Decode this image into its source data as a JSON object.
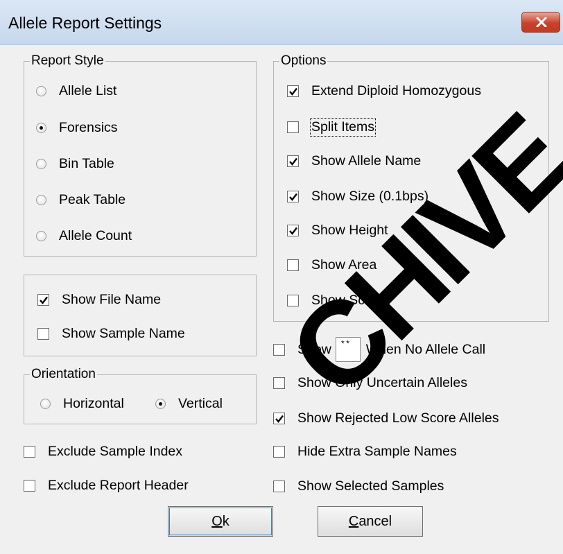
{
  "window": {
    "title": "Allele Report Settings"
  },
  "report_style": {
    "title": "Report Style",
    "options": [
      {
        "label": "Allele List",
        "selected": false
      },
      {
        "label": "Forensics",
        "selected": true
      },
      {
        "label": "Bin Table",
        "selected": false
      },
      {
        "label": "Peak Table",
        "selected": false
      },
      {
        "label": "Allele Count",
        "selected": false
      }
    ]
  },
  "name_options": [
    {
      "label": "Show File Name",
      "checked": true
    },
    {
      "label": "Show Sample Name",
      "checked": false
    }
  ],
  "orientation": {
    "title": "Orientation",
    "options": [
      {
        "label": "Horizontal",
        "selected": false
      },
      {
        "label": "Vertical",
        "selected": true
      }
    ]
  },
  "bottom_left": [
    {
      "label": "Exclude Sample Index",
      "checked": false
    },
    {
      "label": "Exclude Report Header",
      "checked": false
    }
  ],
  "options": {
    "title": "Options",
    "items": [
      {
        "label": "Extend Diploid Homozygous",
        "checked": true
      },
      {
        "label": "Split Items",
        "checked": false
      },
      {
        "label": "Show Allele Name",
        "checked": true
      },
      {
        "label": "Show Size (0.1bps)",
        "checked": true
      },
      {
        "label": "Show Height",
        "checked": true
      },
      {
        "label": "Show Area",
        "checked": false
      },
      {
        "label": "Show Score",
        "checked": false
      }
    ]
  },
  "no_call": {
    "checked": false,
    "prefix": "Show",
    "value": "**",
    "suffix": "When No Allele Call"
  },
  "extra_options": [
    {
      "label": "Show Only Uncertain Alleles",
      "checked": false
    },
    {
      "label": "Show Rejected Low Score Alleles",
      "checked": true
    },
    {
      "label": "Hide Extra Sample Names",
      "checked": false
    },
    {
      "label": "Show Selected Samples",
      "checked": false
    }
  ],
  "buttons": {
    "ok": {
      "mnemonic": "O",
      "rest": "k"
    },
    "cancel": {
      "mnemonic": "C",
      "rest": "ancel"
    }
  },
  "watermark": "CHIVE"
}
